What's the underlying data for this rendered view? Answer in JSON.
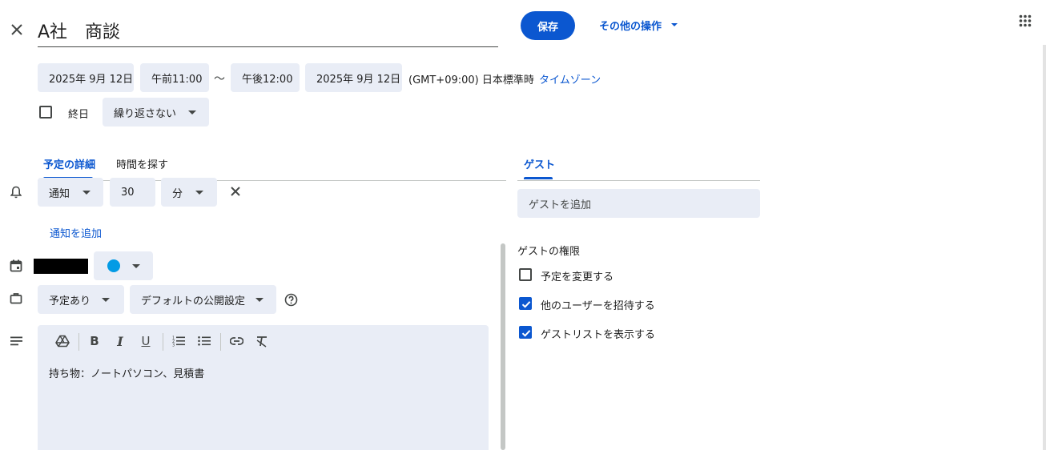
{
  "header": {
    "title": "A社　商談",
    "save_label": "保存",
    "more_actions_label": "その他の操作"
  },
  "datetime": {
    "start_date": "2025年 9月 12日",
    "start_time": "午前11:00",
    "separator": "〜",
    "end_time": "午後12:00",
    "end_date": "2025年 9月 12日",
    "timezone_text": "(GMT+09:00) 日本標準時",
    "timezone_link": "タイムゾーン"
  },
  "allday": {
    "label": "終日",
    "checked": false
  },
  "repeat": {
    "value": "繰り返さない"
  },
  "tabs": [
    {
      "label": "予定の詳細",
      "active": true
    },
    {
      "label": "時間を探す",
      "active": false
    }
  ],
  "notification": {
    "type": "通知",
    "amount": "30",
    "unit": "分",
    "add_label": "通知を追加"
  },
  "calendar": {
    "color": "#039be5"
  },
  "availability": {
    "status": "予定あり",
    "visibility": "デフォルトの公開設定"
  },
  "description": {
    "text": "持ち物：ノートパソコン、見積書"
  },
  "guests": {
    "tab_label": "ゲスト",
    "add_placeholder": "ゲストを追加",
    "permissions_title": "ゲストの権限",
    "permissions": [
      {
        "label": "予定を変更する",
        "checked": false
      },
      {
        "label": "他のユーザーを招待する",
        "checked": true
      },
      {
        "label": "ゲストリストを表示する",
        "checked": true
      }
    ]
  },
  "colors": {
    "accent": "#0b57d0",
    "chip_bg": "#e9edf6"
  }
}
